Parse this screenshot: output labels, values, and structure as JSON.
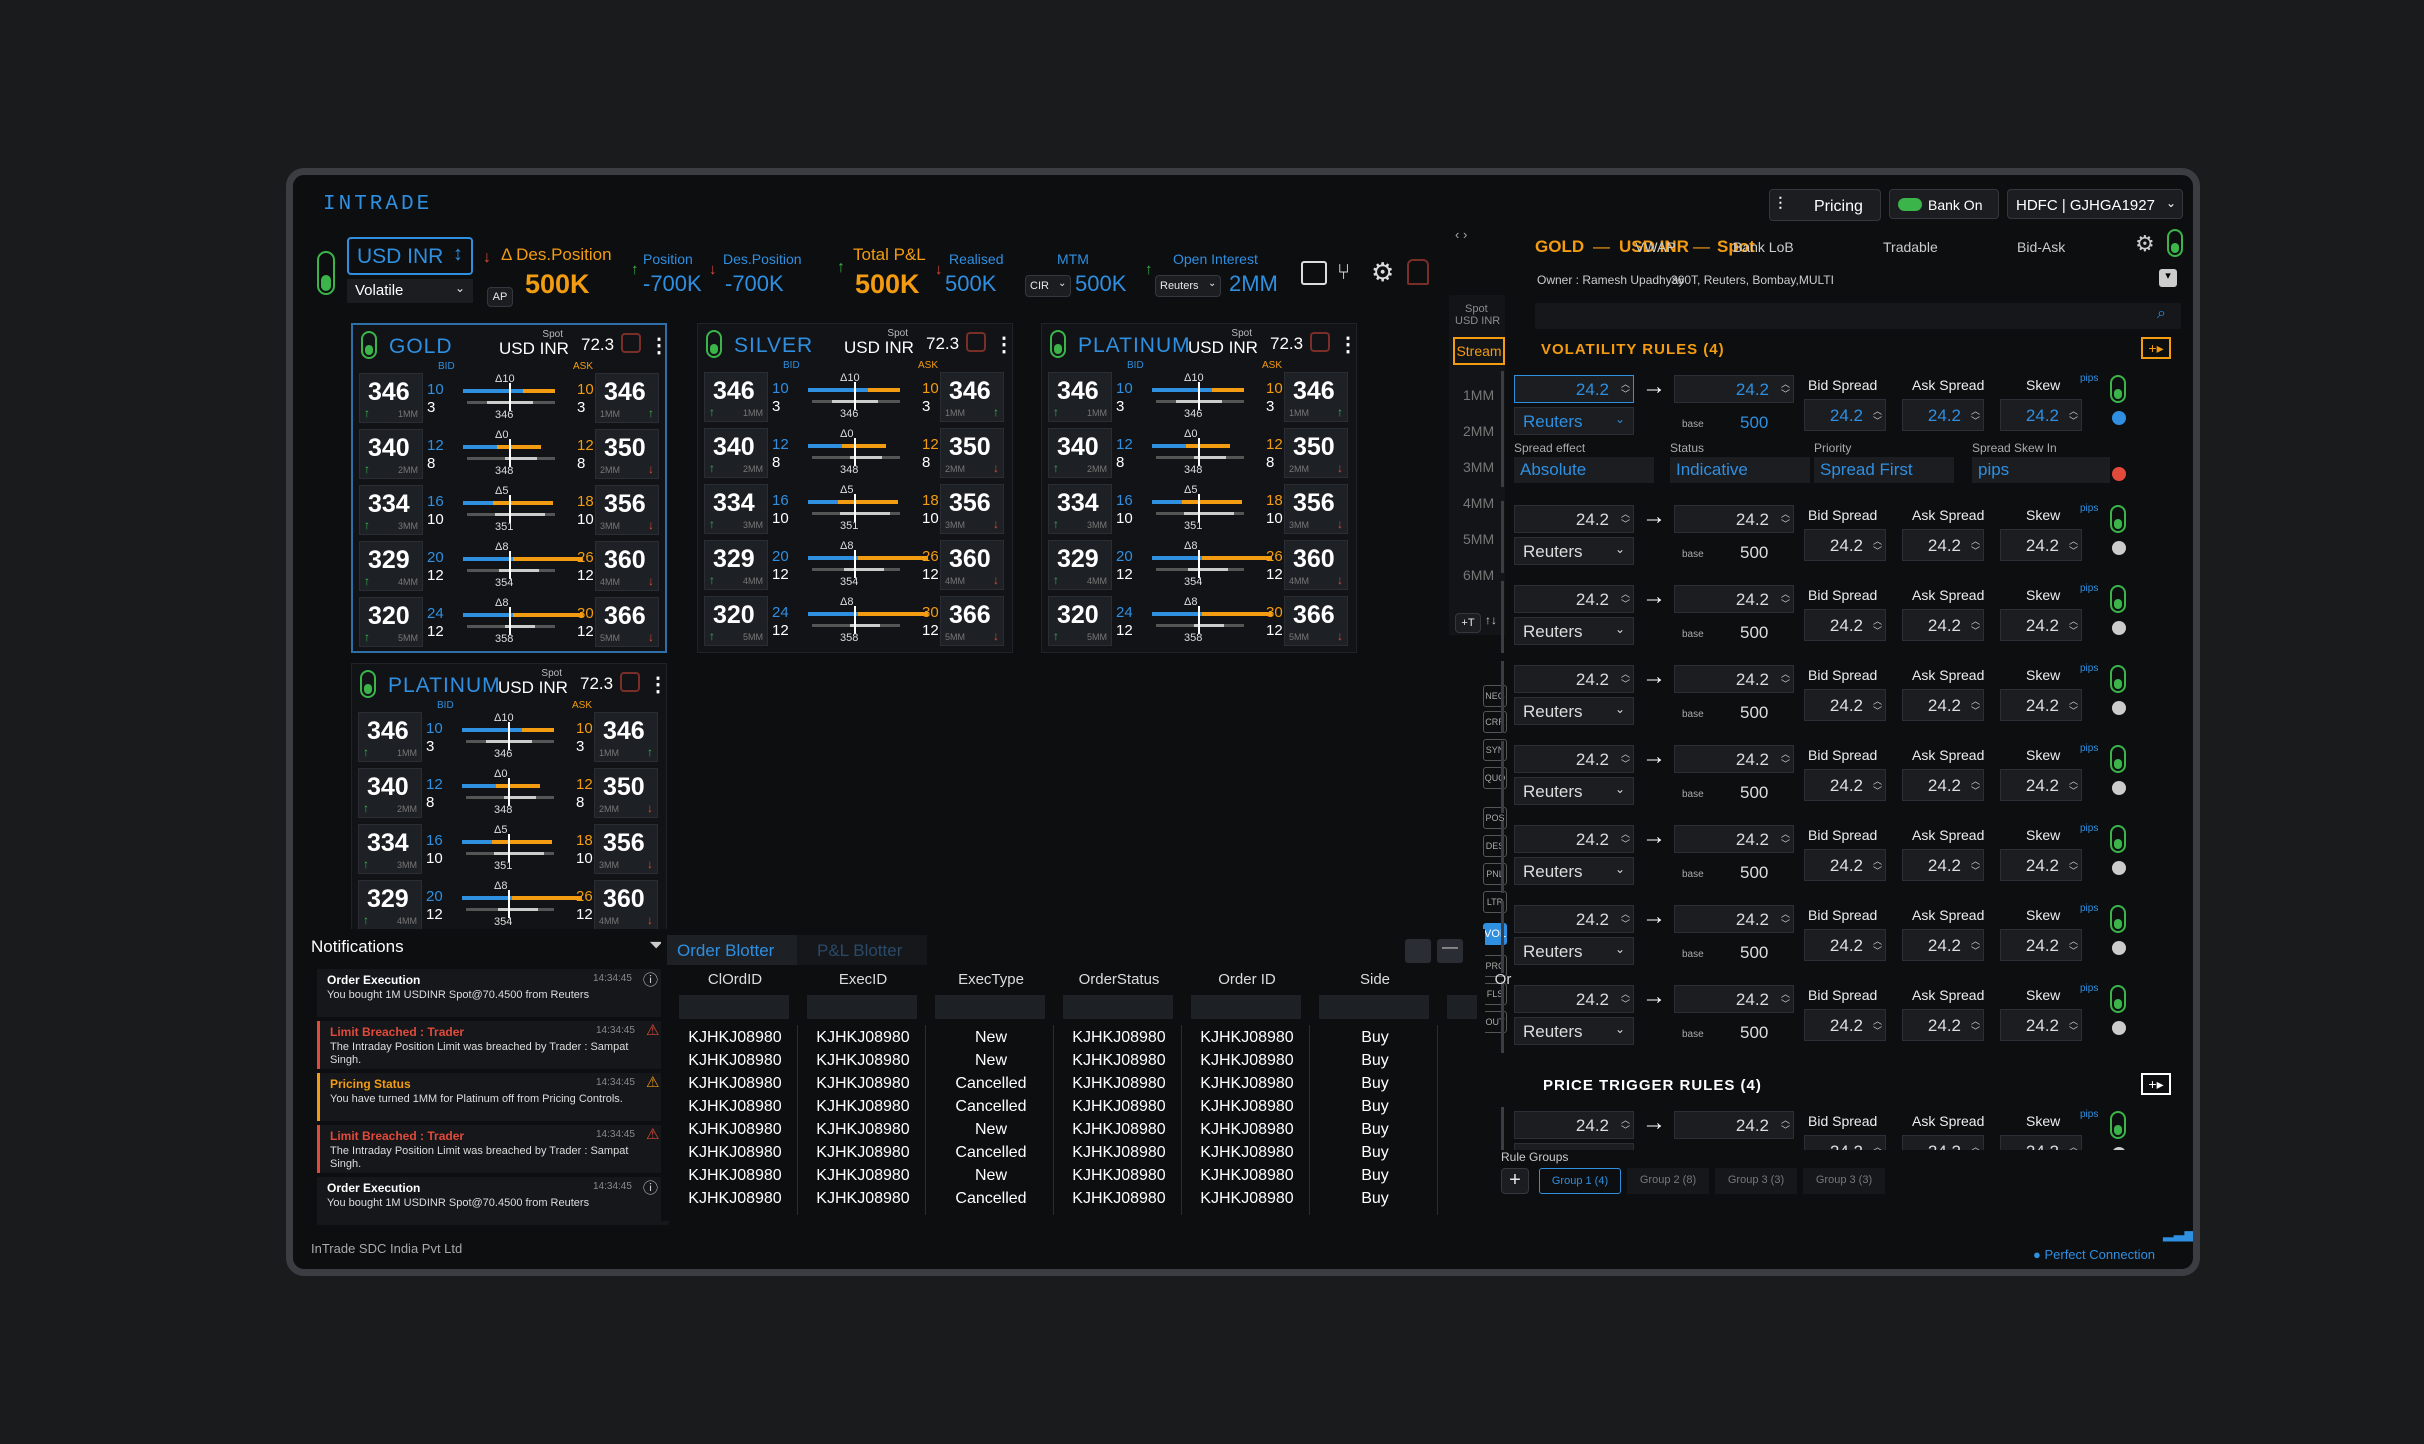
{
  "app": {
    "logo": "INTRADE",
    "pricing": "Pricing",
    "bank_on": "Bank On",
    "account": "HDFC | GJHGA1927",
    "footer": "InTrade SDC India Pvt Ltd",
    "connection": "Perfect Connection"
  },
  "top": {
    "pair": "USD INR",
    "mode": "Volatile",
    "des_position_label": "Des.Position",
    "des_position_value": "500K",
    "ap": "AP",
    "position_label": "Position",
    "position_value": "-700K",
    "des_position2_label": "Des.Position",
    "des_position2_value": "-700K",
    "total_pnl_label": "Total P&L",
    "total_pnl_value": "500K",
    "realised_label": "Realised",
    "realised_value": "500K",
    "mtm_label": "MTM",
    "mtm_select": "CIR",
    "mtm_value": "500K",
    "oi_label": "Open Interest",
    "oi_select": "Reuters",
    "oi_value": "2MM"
  },
  "panels": [
    {
      "name": "GOLD",
      "spot": "Spot",
      "pair": "USD INR",
      "val": "72.3"
    },
    {
      "name": "SILVER",
      "spot": "Spot",
      "pair": "USD INR",
      "val": "72.3"
    },
    {
      "name": "PLATINUM",
      "spot": "Spot",
      "pair": "USD INR",
      "val": "72.3"
    },
    {
      "name": "PLATINUM",
      "spot": "Spot",
      "pair": "USD INR",
      "val": "72.3"
    }
  ],
  "ladder": {
    "bid": "BID",
    "ask": "ASK",
    "rows": [
      {
        "bid": "346",
        "bq": "10",
        "bq2": "3",
        "t": "1MM",
        "d": "Δ10",
        "v": "346",
        "aq": "10",
        "aq2": "3",
        "ask": "346",
        "t2": "1MM"
      },
      {
        "bid": "340",
        "bq": "12",
        "bq2": "8",
        "t": "2MM",
        "d": "Δ0",
        "v": "348",
        "aq": "12",
        "aq2": "8",
        "ask": "350",
        "t2": "2MM"
      },
      {
        "bid": "334",
        "bq": "16",
        "bq2": "10",
        "t": "3MM",
        "d": "Δ5",
        "v": "351",
        "aq": "18",
        "aq2": "10",
        "ask": "356",
        "t2": "3MM"
      },
      {
        "bid": "329",
        "bq": "20",
        "bq2": "12",
        "t": "4MM",
        "d": "Δ8",
        "v": "354",
        "aq": "26",
        "aq2": "12",
        "ask": "360",
        "t2": "4MM"
      },
      {
        "bid": "320",
        "bq": "24",
        "bq2": "12",
        "t": "5MM",
        "d": "Δ8",
        "v": "358",
        "aq": "30",
        "aq2": "12",
        "ask": "366",
        "t2": "5MM"
      }
    ]
  },
  "tenor": {
    "spot": "Spot",
    "pair": "USD INR",
    "stream": "Stream",
    "items": [
      "1MM",
      "2MM",
      "3MM",
      "4MM",
      "5MM",
      "6MM"
    ],
    "add": "+T"
  },
  "side_tags": [
    "NEG",
    "CRR",
    "SYN",
    "QUO",
    "POS",
    "DES",
    "PNL",
    "LTR",
    "VOL",
    "PRC",
    "FLS",
    "OUT"
  ],
  "right": {
    "instrument": "GOLD",
    "pair": "USD INR",
    "type": "Spot",
    "tabs": [
      "VWAP",
      "Bank LoB",
      "Tradable",
      "Bid-Ask"
    ],
    "owner": "Owner : Ramesh Upadhyay",
    "venues": "360T, Reuters, Bombay,MULTI",
    "vol_title": "VOLATILITY RULES (4)",
    "price_title": "PRICE TRIGGER RULES (4)",
    "rule": {
      "v1": "24.2",
      "v2": "24.2",
      "src": "Reuters",
      "base": "base",
      "bval": "500",
      "bid_spread": "Bid Spread",
      "ask_spread": "Ask Spread",
      "skew": "Skew",
      "sp": "24.2",
      "pips": "pips"
    },
    "first": {
      "spread_effect": "Spread effect",
      "spread_effect_val": "Absolute",
      "status": "Status",
      "status_val": "Indicative",
      "priority": "Priority",
      "priority_val": "Spread First",
      "skew_in": "Spread Skew In",
      "skew_in_val": "pips"
    },
    "rule_groups": "Rule Groups",
    "groups": [
      "Group 1 (4)",
      "Group 2 (8)",
      "Group 3 (3)",
      "Group 3 (3)"
    ]
  },
  "notifications": {
    "title": "Notifications",
    "items": [
      {
        "title": "Order Execution",
        "time": "14:34:45",
        "text": "You bought 1M USDINR Spot@70.4500 from Reuters"
      },
      {
        "title": "Limit Breached : Trader",
        "time": "14:34:45",
        "text": "The Intraday Position Limit was breached by Trader : Sampat Singh."
      },
      {
        "title": "Pricing Status",
        "time": "14:34:45",
        "text": "You have turned 1MM for Platinum off from Pricing Controls."
      },
      {
        "title": "Limit Breached : Trader",
        "time": "14:34:45",
        "text": "The Intraday Position Limit was breached by Trader : Sampat Singh."
      },
      {
        "title": "Order Execution",
        "time": "14:34:45",
        "text": "You bought 1M USDINR Spot@70.4500 from Reuters"
      }
    ]
  },
  "blotter": {
    "tab1": "Order Blotter",
    "tab2": "P&L Blotter",
    "columns": [
      "ClOrdID",
      "ExecID",
      "ExecType",
      "OrderStatus",
      "Order ID",
      "Side",
      "Or"
    ],
    "rows": [
      [
        "KJHKJ08980",
        "KJHKJ08980",
        "New",
        "KJHKJ08980",
        "KJHKJ08980",
        "Buy"
      ],
      [
        "KJHKJ08980",
        "KJHKJ08980",
        "New",
        "KJHKJ08980",
        "KJHKJ08980",
        "Buy"
      ],
      [
        "KJHKJ08980",
        "KJHKJ08980",
        "Cancelled",
        "KJHKJ08980",
        "KJHKJ08980",
        "Buy"
      ],
      [
        "KJHKJ08980",
        "KJHKJ08980",
        "Cancelled",
        "KJHKJ08980",
        "KJHKJ08980",
        "Buy"
      ],
      [
        "KJHKJ08980",
        "KJHKJ08980",
        "New",
        "KJHKJ08980",
        "KJHKJ08980",
        "Buy"
      ],
      [
        "KJHKJ08980",
        "KJHKJ08980",
        "Cancelled",
        "KJHKJ08980",
        "KJHKJ08980",
        "Buy"
      ],
      [
        "KJHKJ08980",
        "KJHKJ08980",
        "New",
        "KJHKJ08980",
        "KJHKJ08980",
        "Buy"
      ],
      [
        "KJHKJ08980",
        "KJHKJ08980",
        "Cancelled",
        "KJHKJ08980",
        "KJHKJ08980",
        "Buy"
      ]
    ]
  }
}
